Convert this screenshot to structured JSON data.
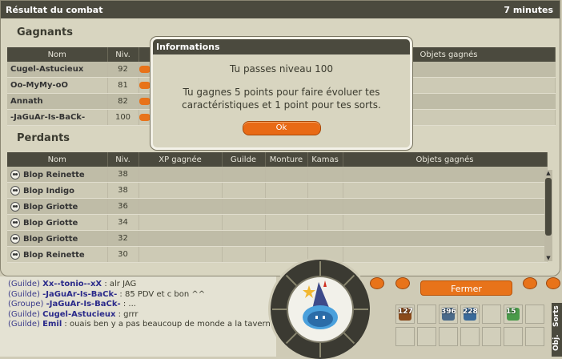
{
  "result_window": {
    "title": "Résultat du combat",
    "timer": "7 minutes",
    "winners_title": "Gagnants",
    "losers_title": "Perdants",
    "columns": [
      "Nom",
      "Niv.",
      "XP gagnée",
      "Guilde",
      "Monture",
      "Kamas",
      "Objets gagnés"
    ],
    "winners": [
      {
        "name": "Cugel-Astucieux",
        "level": "92"
      },
      {
        "name": "Oo-MyMy-oO",
        "level": "81"
      },
      {
        "name": "Annath",
        "level": "82"
      },
      {
        "name": "-JaGuAr-Is-BaCk-",
        "level": "100"
      }
    ],
    "losers": [
      {
        "name": "Blop Reinette",
        "level": "38"
      },
      {
        "name": "Blop Indigo",
        "level": "38"
      },
      {
        "name": "Blop Griotte",
        "level": "36"
      },
      {
        "name": "Blop Griotte",
        "level": "34"
      },
      {
        "name": "Blop Griotte",
        "level": "32"
      },
      {
        "name": "Blop Reinette",
        "level": "30"
      }
    ]
  },
  "info_dialog": {
    "title": "Informations",
    "line1": "Tu passes niveau 100",
    "line2": "Tu gagnes 5 points pour faire évoluer tes caractéristiques et 1 point pour tes sorts.",
    "ok_label": "Ok"
  },
  "chat": [
    {
      "channel": "(Guilde)",
      "author": "Xx--tonio--xX",
      "text": " : alr JAG"
    },
    {
      "channel": "(Guilde)",
      "author": "-JaGuAr-Is-BaCk-",
      "text": " : 85 PDV et c bon ^^"
    },
    {
      "channel": "(Groupe)",
      "author": "-JaGuAr-Is-BaCk-",
      "text": " : ..."
    },
    {
      "channel": "(Guilde)",
      "author": "Cugel-Astucieux",
      "text": " : grrr"
    },
    {
      "channel": "(Guilde)",
      "author": "Emil",
      "text": " : ouais ben y a pas beaucoup de monde a la taverne"
    }
  ],
  "hud": {
    "close_label": "Fermer",
    "slots": [
      "127",
      "396",
      "228",
      "15"
    ],
    "tab_spells": "Sorts",
    "tab_items": "Obj."
  },
  "colors": {
    "accent": "#e8731a",
    "header": "#4b4a3e",
    "panel": "#d8d5c0"
  }
}
